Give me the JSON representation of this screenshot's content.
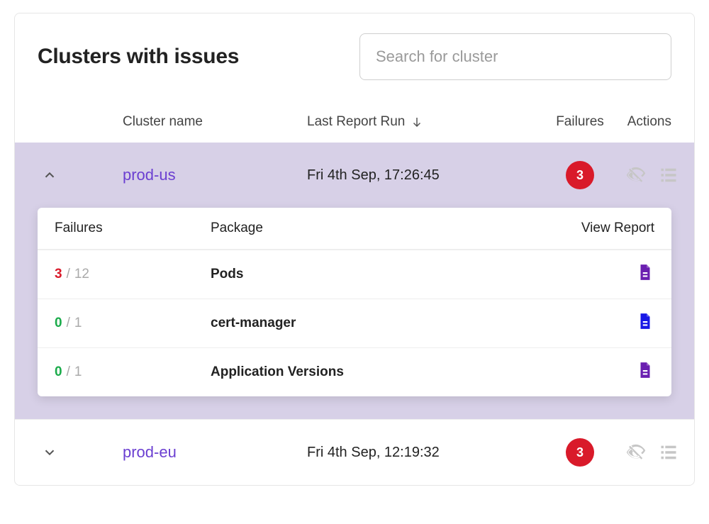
{
  "title": "Clusters with issues",
  "search": {
    "placeholder": "Search for cluster"
  },
  "columns": {
    "name": "Cluster name",
    "last_run": "Last Report Run",
    "failures": "Failures",
    "actions": "Actions"
  },
  "clusters": [
    {
      "name": "prod-us",
      "last_run": "Fri 4th Sep, 17:26:45",
      "failures_badge": "3",
      "expanded": true,
      "detail_headers": {
        "failures": "Failures",
        "package": "Package",
        "view_report": "View Report"
      },
      "details": [
        {
          "fail": "3",
          "total": "12",
          "fail_color": "red",
          "package": "Pods",
          "report_color": "purple"
        },
        {
          "fail": "0",
          "total": "1",
          "fail_color": "green",
          "package": "cert-manager",
          "report_color": "blue"
        },
        {
          "fail": "0",
          "total": "1",
          "fail_color": "green",
          "package": "Application Versions",
          "report_color": "purple"
        }
      ]
    },
    {
      "name": "prod-eu",
      "last_run": "Fri 4th Sep, 12:19:32",
      "failures_badge": "3",
      "expanded": false
    }
  ]
}
